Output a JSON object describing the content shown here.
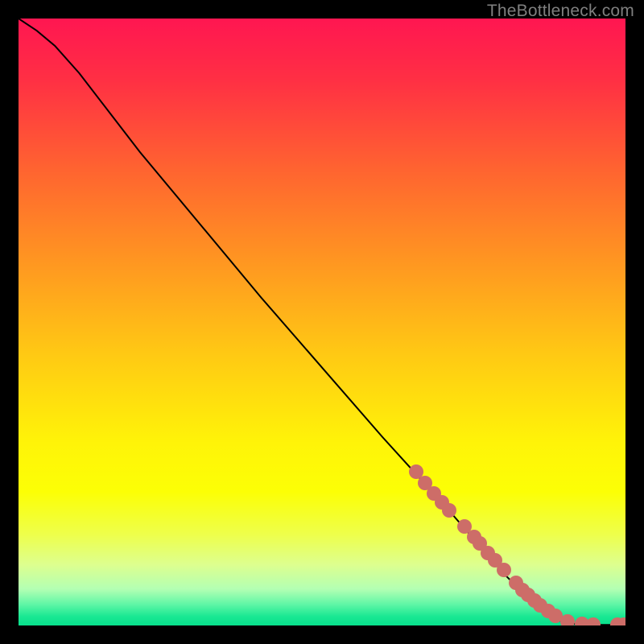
{
  "watermark": "TheBottleneck.com",
  "colors": {
    "dot": "#cd6d68",
    "curve": "#000000",
    "frame": "#000000"
  },
  "chart_data": {
    "type": "line",
    "title": "",
    "xlabel": "",
    "ylabel": "",
    "xlim": [
      0,
      100
    ],
    "ylim": [
      0,
      100
    ],
    "gradient_stops": [
      {
        "pos": 0.0,
        "color": "#ff1651"
      },
      {
        "pos": 0.1,
        "color": "#ff2f44"
      },
      {
        "pos": 0.25,
        "color": "#ff6430"
      },
      {
        "pos": 0.4,
        "color": "#ff9621"
      },
      {
        "pos": 0.55,
        "color": "#ffc814"
      },
      {
        "pos": 0.7,
        "color": "#fff408"
      },
      {
        "pos": 0.78,
        "color": "#fcff05"
      },
      {
        "pos": 0.85,
        "color": "#eeff4b"
      },
      {
        "pos": 0.9,
        "color": "#ddff8f"
      },
      {
        "pos": 0.94,
        "color": "#b3ffb3"
      },
      {
        "pos": 0.965,
        "color": "#60f6a6"
      },
      {
        "pos": 0.985,
        "color": "#1ae893"
      },
      {
        "pos": 1.0,
        "color": "#07e08c"
      }
    ],
    "series": [
      {
        "name": "bottleneck-curve",
        "x": [
          0,
          3,
          6,
          10,
          15,
          20,
          30,
          40,
          50,
          60,
          70,
          80,
          85,
          88,
          90,
          92,
          95,
          100
        ],
        "y": [
          100,
          98,
          95.5,
          91,
          84.5,
          78,
          66,
          54,
          42.5,
          31,
          20,
          8.5,
          3.5,
          1.2,
          0.5,
          0.2,
          0.1,
          0.1
        ]
      }
    ],
    "dots": {
      "name": "highlighted-points",
      "x": [
        65.5,
        67,
        68.5,
        69.8,
        71,
        73.5,
        75,
        76,
        77.3,
        78.5,
        80,
        82,
        83,
        84,
        85,
        86,
        87.3,
        88.5,
        90.5,
        92.8,
        94.7,
        98.7,
        99.7
      ],
      "y": [
        25.3,
        23.5,
        21.8,
        20.3,
        19,
        16.3,
        14.6,
        13.5,
        12.0,
        10.7,
        9.2,
        7.0,
        5.9,
        5.0,
        4.1,
        3.3,
        2.4,
        1.55,
        0.65,
        0.25,
        0.15,
        0.12,
        0.1
      ]
    }
  }
}
